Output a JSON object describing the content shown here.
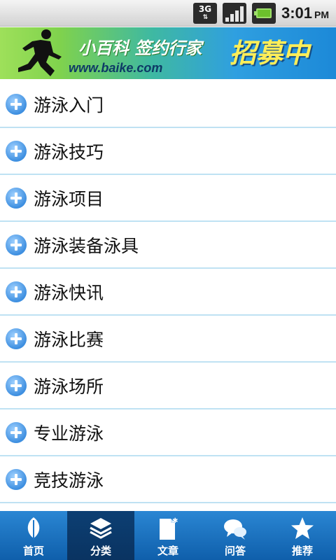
{
  "status_bar": {
    "network": "3G",
    "time": "3:01",
    "ampm": "PM"
  },
  "banner": {
    "slogan": "小百科 签约行家",
    "url": "www.baike.com",
    "headline": "招募中"
  },
  "list": {
    "items": [
      {
        "label": "游泳入门"
      },
      {
        "label": "游泳技巧"
      },
      {
        "label": "游泳项目"
      },
      {
        "label": "游泳装备泳具"
      },
      {
        "label": "游泳快讯"
      },
      {
        "label": "游泳比赛"
      },
      {
        "label": "游泳场所"
      },
      {
        "label": "专业游泳"
      },
      {
        "label": "竞技游泳"
      }
    ]
  },
  "bottom_nav": {
    "items": [
      {
        "label": "首页",
        "icon": "leaf-icon"
      },
      {
        "label": "分类",
        "icon": "layers-icon"
      },
      {
        "label": "文章",
        "icon": "document-icon"
      },
      {
        "label": "问答",
        "icon": "chat-bubbles-icon"
      },
      {
        "label": "推荐",
        "icon": "star-icon"
      }
    ],
    "active_index": 1
  },
  "colors": {
    "nav_bg": "#1f77c8",
    "nav_active": "#0c3f73",
    "divider": "#bfe2f3",
    "plus_icon": "#3e8fe0"
  }
}
